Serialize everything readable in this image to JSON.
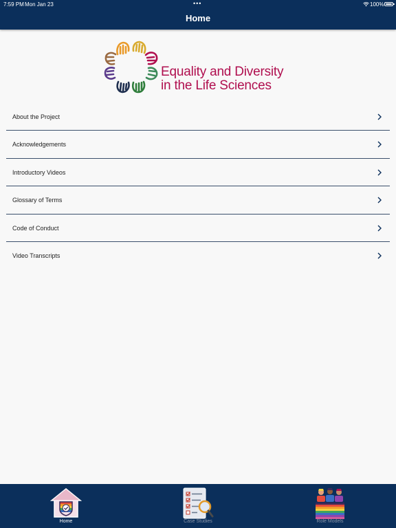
{
  "status_bar": {
    "time": "7:59 PM",
    "date": "Mon Jan 23",
    "dots": "•••",
    "battery": "100%"
  },
  "nav": {
    "title": "Home"
  },
  "logo": {
    "line1": "Equality and Diversity",
    "line2": "in the Life Sciences",
    "text_color": "#b00f4f",
    "hand_colors": [
      "#e99a2a",
      "#d9ab2f",
      "#b00f4f",
      "#3d8a5a",
      "#2f7d3b",
      "#1f2f4f",
      "#5b3b8c",
      "#9a6b43"
    ]
  },
  "menu": {
    "items": [
      {
        "label": "About the Project"
      },
      {
        "label": "Acknowledgements"
      },
      {
        "label": "Introductory Videos"
      },
      {
        "label": "Glossary of Terms"
      },
      {
        "label": "Code of Conduct"
      },
      {
        "label": "Video Transcripts"
      }
    ],
    "chevron_color": "#0b2f5b"
  },
  "tabbar": {
    "tabs": [
      {
        "label": "Home",
        "icon": "home-shield-icon",
        "active": true
      },
      {
        "label": "Case Studies",
        "icon": "checklist-magnifier-icon",
        "active": false
      },
      {
        "label": "Role Models",
        "icon": "people-books-icon",
        "active": false
      }
    ]
  },
  "colors": {
    "nav_background": "#0b2f5b",
    "page_background": "#f8f8f8"
  }
}
